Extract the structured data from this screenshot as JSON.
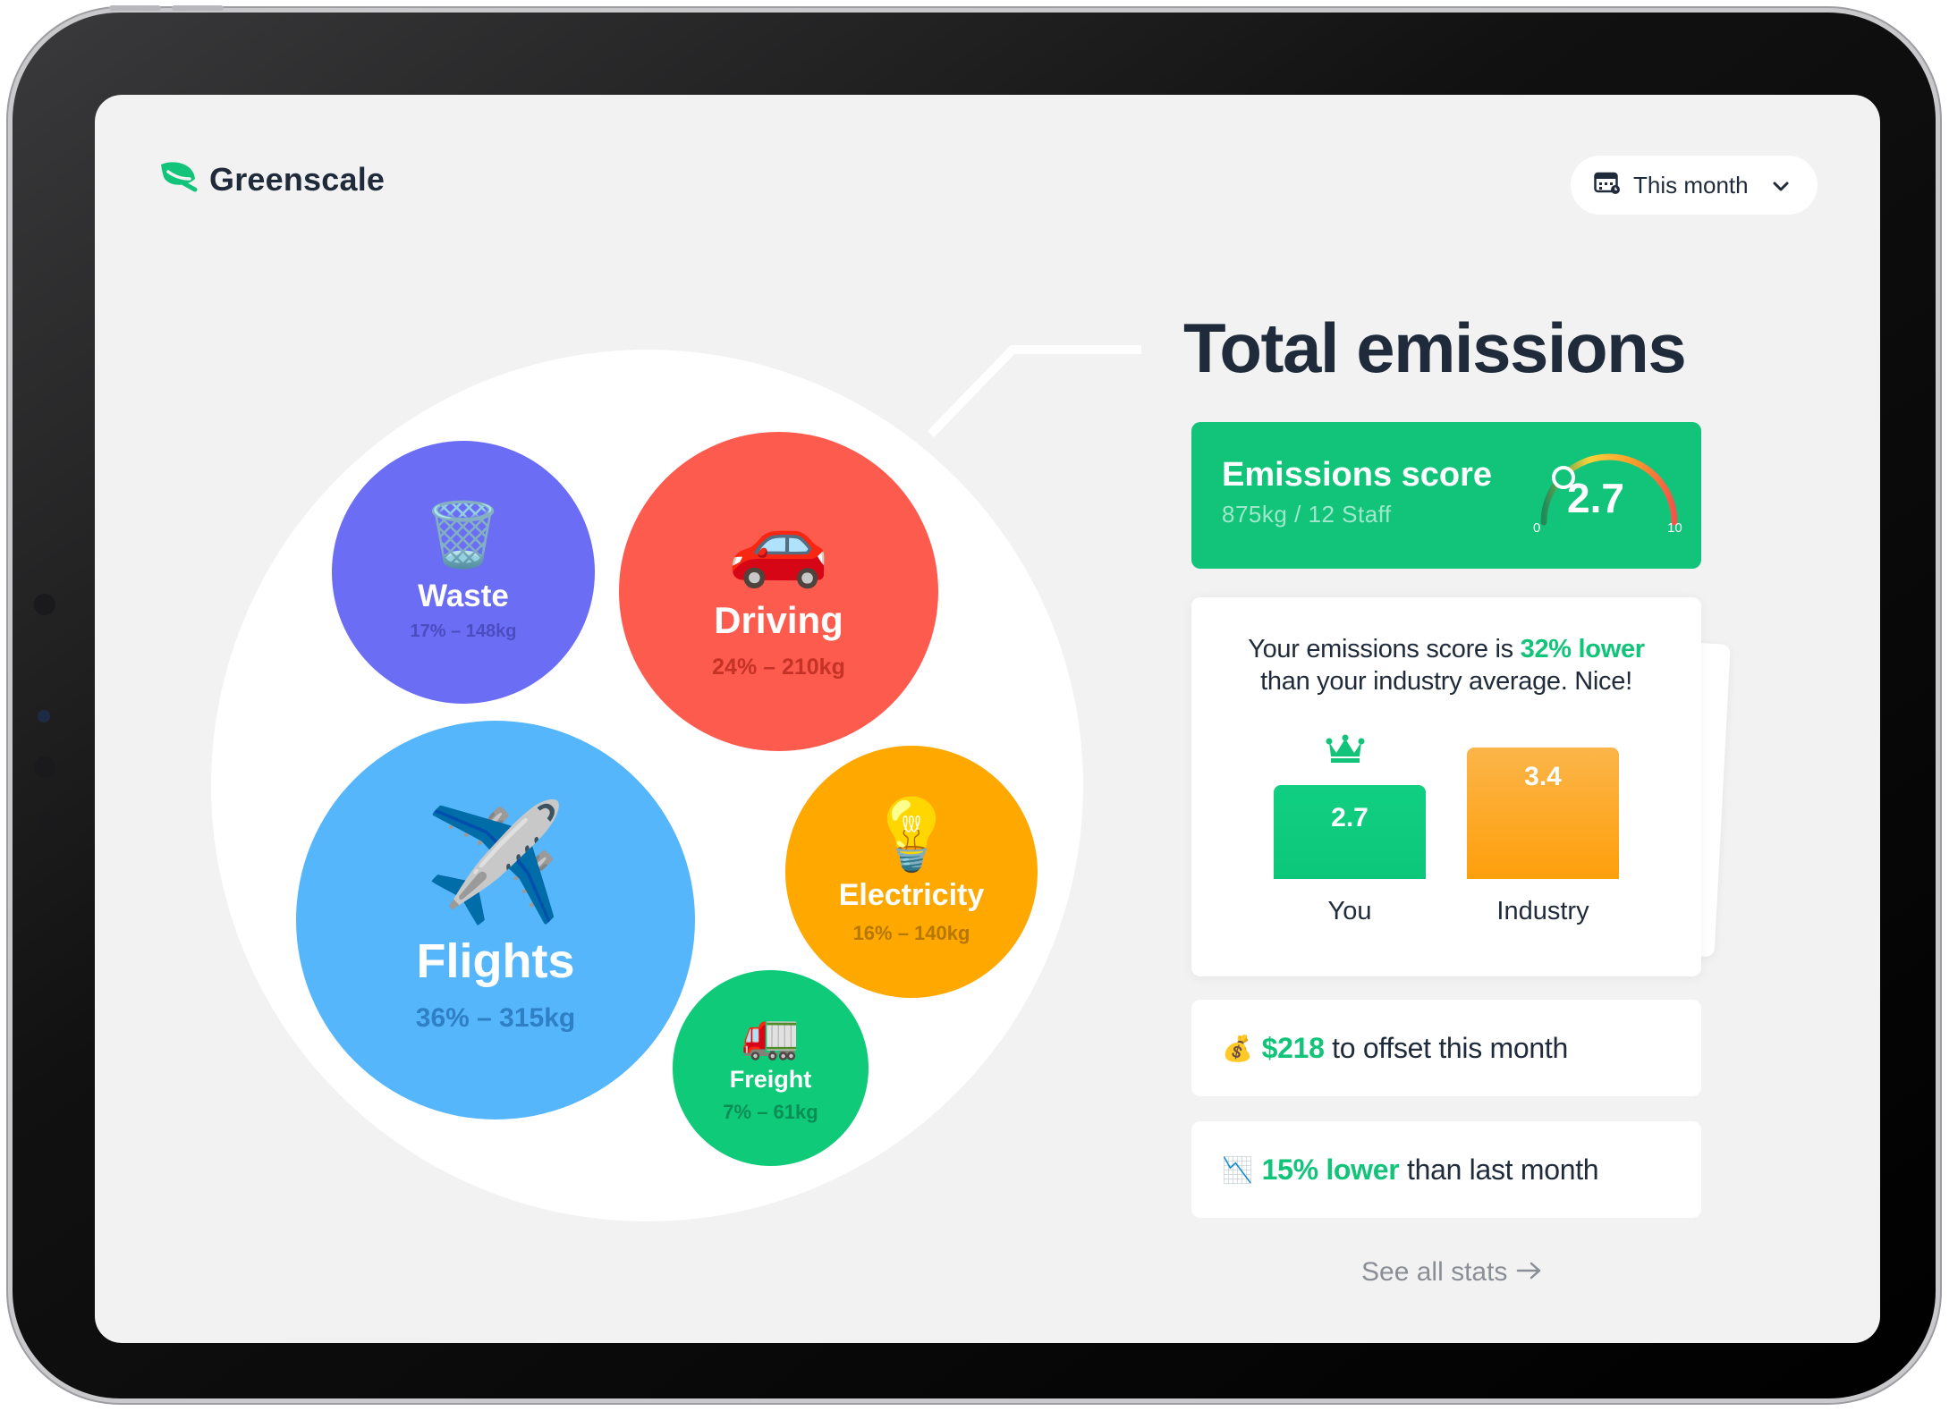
{
  "brand": {
    "name": "Greenscale",
    "icon": "leaf-icon",
    "color": "#11c47a"
  },
  "period_selector": {
    "label": "This month",
    "icon": "calendar-icon"
  },
  "title": "Total emissions",
  "categories": [
    {
      "name": "Waste",
      "stat": "17% – 148kg",
      "color": "#6b6df5",
      "emoji": "🗑️"
    },
    {
      "name": "Driving",
      "stat": "24% – 210kg",
      "color": "#fd5b4e",
      "emoji": "🚗"
    },
    {
      "name": "Flights",
      "stat": "36% – 315kg",
      "color": "#56b6fc",
      "emoji": "✈️"
    },
    {
      "name": "Electricity",
      "stat": "16% – 140kg",
      "color": "#fea800",
      "emoji": "💡"
    },
    {
      "name": "Freight",
      "stat": "7% – 61kg",
      "color": "#0fca78",
      "emoji": "🚛"
    }
  ],
  "score": {
    "label": "Emissions score",
    "sub": "875kg / 12 Staff",
    "value": "2.7",
    "min": "0",
    "max": "10"
  },
  "comparison": {
    "line1_prefix": "Your emissions score is ",
    "line1_highlight": "32% lower",
    "line2": "than your industry average. Nice!",
    "you_value": "2.7",
    "you_label": "You",
    "industry_value": "3.4",
    "industry_label": "Industry"
  },
  "offset": {
    "emoji": "💰",
    "highlight": "$218",
    "text": " to offset this month"
  },
  "trend": {
    "emoji": "📉",
    "highlight": "15% lower",
    "text": " than last month"
  },
  "see_all": "See all stats"
}
